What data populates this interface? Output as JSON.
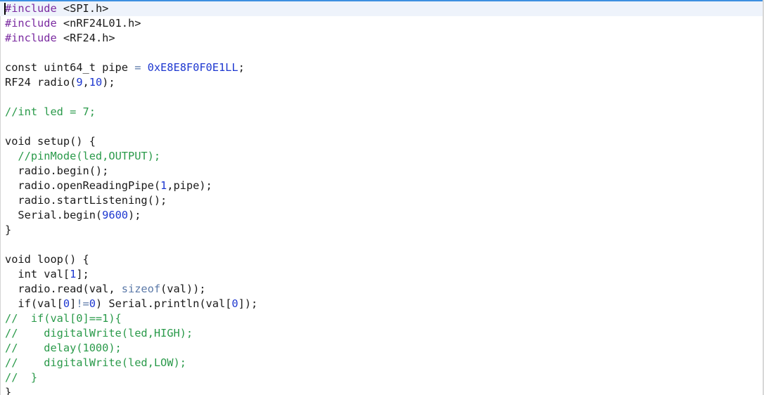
{
  "editor": {
    "lines": [
      [
        {
          "t": "#include",
          "c": "pp"
        },
        {
          "t": " <SPI.h>",
          "c": "pl"
        }
      ],
      [
        {
          "t": "#include",
          "c": "pp"
        },
        {
          "t": " <nRF24L01.h>",
          "c": "pl"
        }
      ],
      [
        {
          "t": "#include",
          "c": "pp"
        },
        {
          "t": " <RF24.h>",
          "c": "pl"
        }
      ],
      [],
      [
        {
          "t": "const uint64_t pipe ",
          "c": "pl"
        },
        {
          "t": "=",
          "c": "op"
        },
        {
          "t": " ",
          "c": "pl"
        },
        {
          "t": "0xE8E8F0F0E1LL",
          "c": "num"
        },
        {
          "t": ";",
          "c": "pl"
        }
      ],
      [
        {
          "t": "RF24 radio(",
          "c": "pl"
        },
        {
          "t": "9",
          "c": "num"
        },
        {
          "t": ",",
          "c": "pl"
        },
        {
          "t": "10",
          "c": "num"
        },
        {
          "t": ");",
          "c": "pl"
        }
      ],
      [],
      [
        {
          "t": "//int led = 7;",
          "c": "cm"
        }
      ],
      [],
      [
        {
          "t": "void setup() {",
          "c": "pl"
        }
      ],
      [
        {
          "t": "  ",
          "c": "pl"
        },
        {
          "t": "//pinMode(led,OUTPUT);",
          "c": "cm"
        }
      ],
      [
        {
          "t": "  radio.begin();",
          "c": "pl"
        }
      ],
      [
        {
          "t": "  radio.openReadingPipe(",
          "c": "pl"
        },
        {
          "t": "1",
          "c": "num"
        },
        {
          "t": ",pipe);",
          "c": "pl"
        }
      ],
      [
        {
          "t": "  radio.startListening();",
          "c": "pl"
        }
      ],
      [
        {
          "t": "  Serial.begin(",
          "c": "pl"
        },
        {
          "t": "9600",
          "c": "num"
        },
        {
          "t": ");",
          "c": "pl"
        }
      ],
      [
        {
          "t": "}",
          "c": "pl"
        }
      ],
      [],
      [
        {
          "t": "void loop() {",
          "c": "pl"
        }
      ],
      [
        {
          "t": "  ",
          "c": "pl"
        },
        {
          "t": "int",
          "c": "kw"
        },
        {
          "t": " val[",
          "c": "pl"
        },
        {
          "t": "1",
          "c": "num"
        },
        {
          "t": "];",
          "c": "pl"
        }
      ],
      [
        {
          "t": "  radio.read(val, ",
          "c": "pl"
        },
        {
          "t": "sizeof",
          "c": "bi"
        },
        {
          "t": "(val));",
          "c": "pl"
        }
      ],
      [
        {
          "t": "  if(val[",
          "c": "pl"
        },
        {
          "t": "0",
          "c": "num"
        },
        {
          "t": "]",
          "c": "pl"
        },
        {
          "t": "!=",
          "c": "op"
        },
        {
          "t": "0",
          "c": "num"
        },
        {
          "t": ") Serial.println(val[",
          "c": "pl"
        },
        {
          "t": "0",
          "c": "num"
        },
        {
          "t": "]);",
          "c": "pl"
        }
      ],
      [
        {
          "t": "//  if(val[0]==1){",
          "c": "cm"
        }
      ],
      [
        {
          "t": "//    digitalWrite(led,HIGH);",
          "c": "cm"
        }
      ],
      [
        {
          "t": "//    delay(1000);",
          "c": "cm"
        }
      ],
      [
        {
          "t": "//    digitalWrite(led,LOW);",
          "c": "cm"
        }
      ],
      [
        {
          "t": "//  }",
          "c": "cm"
        }
      ],
      [
        {
          "t": "}",
          "c": "pl"
        }
      ]
    ],
    "colors": {
      "preprocessor": "#7a2aa0",
      "number": "#1d37d0",
      "operator": "#5b79a8",
      "comment": "#2a9a4a",
      "text": "#1a1a1a",
      "accent": "#3d8fe0"
    }
  }
}
